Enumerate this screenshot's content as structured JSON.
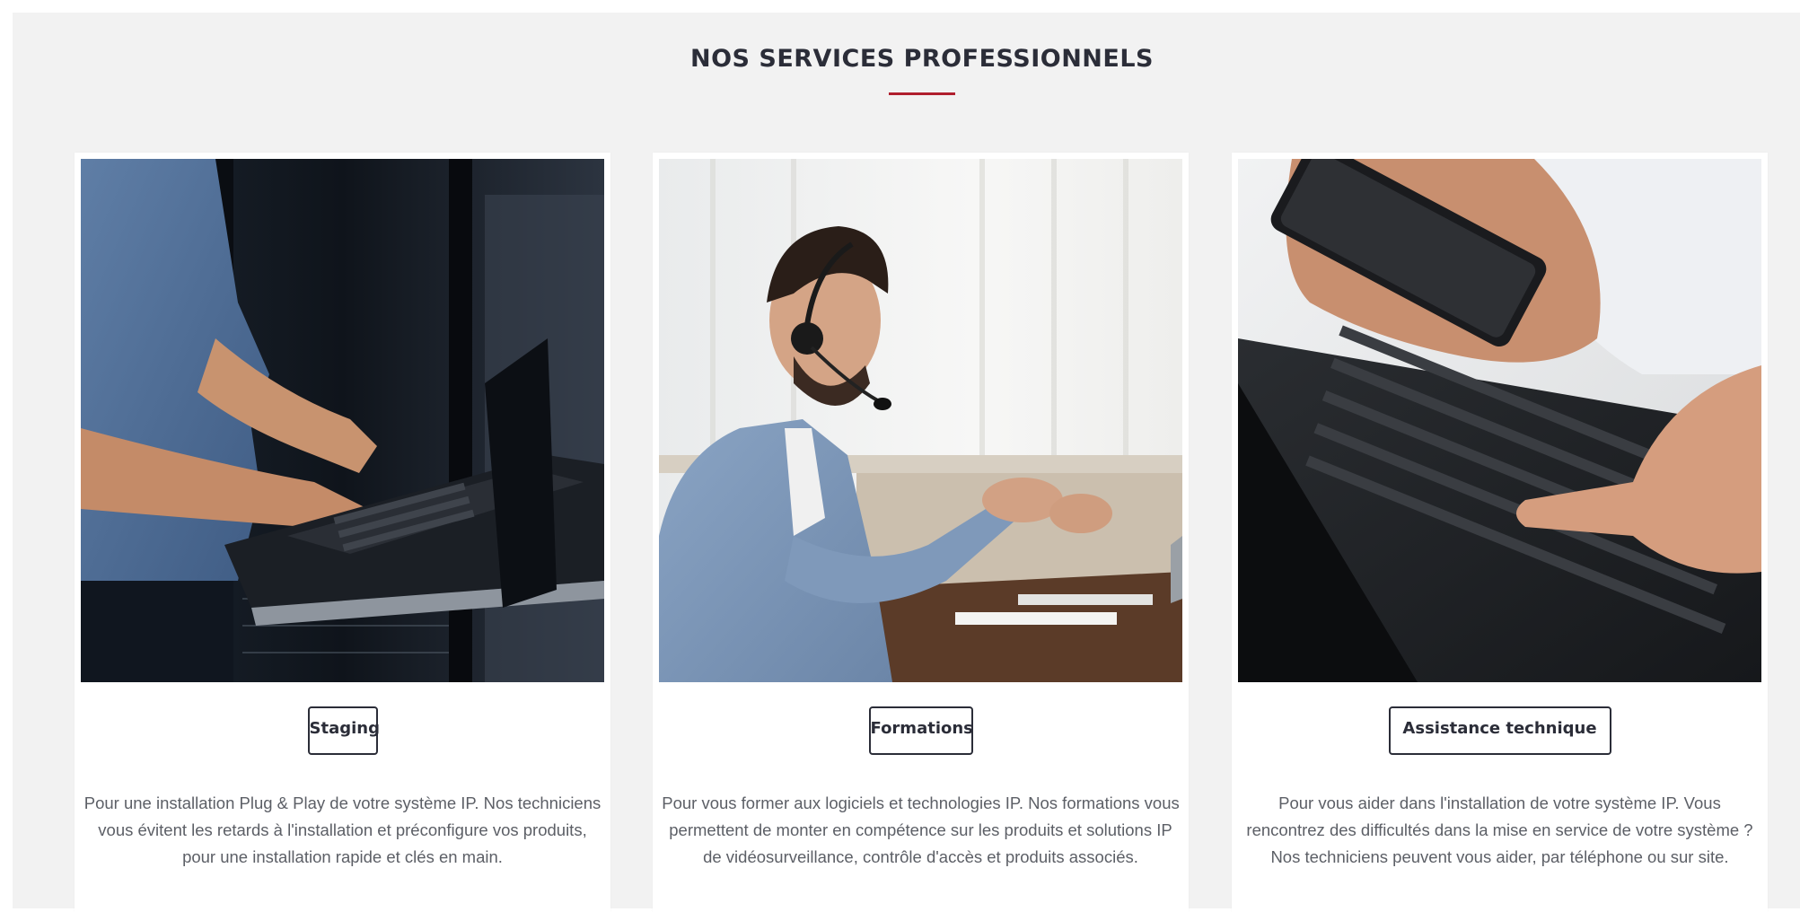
{
  "section": {
    "title": "NOS SERVICES PROFESSIONNELS",
    "accent_color": "#b01f2e",
    "text_color": "#2b2d38"
  },
  "cards": [
    {
      "image_icon": "technician-laptop-server-photo",
      "button_label": "Staging",
      "description": "Pour une installation Plug & Play de votre système IP. Nos techniciens vous évitent les retards à l'installation et préconfigure vos produits, pour une installation rapide et clés en main."
    },
    {
      "image_icon": "headset-trainer-photo",
      "button_label": "Formations",
      "description": "Pour vous former aux logiciels et technologies IP. Nos formations vous permettent de monter en compétence sur les produits et solutions IP de vidéosurveillance, contrôle d'accès et produits associés."
    },
    {
      "image_icon": "phone-keyboard-photo",
      "button_label": "Assistance technique",
      "description": "Pour vous aider dans l'installation de votre système IP. Vous rencontrez des difficultés dans la mise en service de votre système ? Nos techniciens peuvent vous aider, par téléphone ou sur site."
    }
  ]
}
